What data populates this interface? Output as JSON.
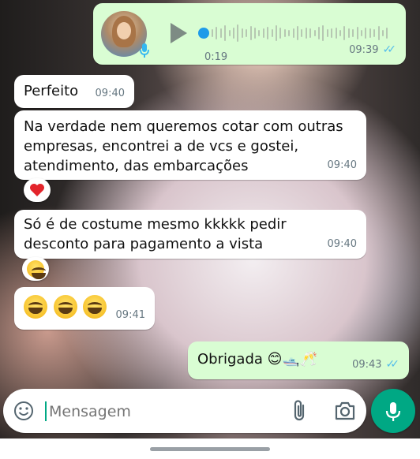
{
  "voice_message": {
    "duration": "0:19",
    "time": "09:39"
  },
  "messages": [
    {
      "text": "Perfeito",
      "time": "09:40"
    },
    {
      "line1": "Na verdade nem queremos cotar com outras",
      "line2": "empresas, encontrei a de vcs e gostei,",
      "line3": "atendimento, das embarcações",
      "time": "09:40",
      "reaction": "❤️"
    },
    {
      "line1": "Só é de costume mesmo kkkkk pedir",
      "line2": "desconto para pagamento a vista",
      "time": "09:40",
      "reaction": "😂"
    },
    {
      "emojis": "😅😅😅",
      "time": "09:41"
    }
  ],
  "outgoing": {
    "text": "Obrigada",
    "emoji": "😊🛥️🥂",
    "time": "09:43"
  },
  "input": {
    "placeholder": "Mensagem"
  },
  "colors": {
    "accent": "#00a884",
    "outgoing_bubble": "#d9fdd3",
    "read_ticks": "#53bdeb"
  },
  "icons": [
    "play-icon",
    "microphone-icon",
    "emoji-icon",
    "attach-icon",
    "camera-icon",
    "double-check-icon",
    "heart-icon",
    "laughing-emoji-icon"
  ]
}
